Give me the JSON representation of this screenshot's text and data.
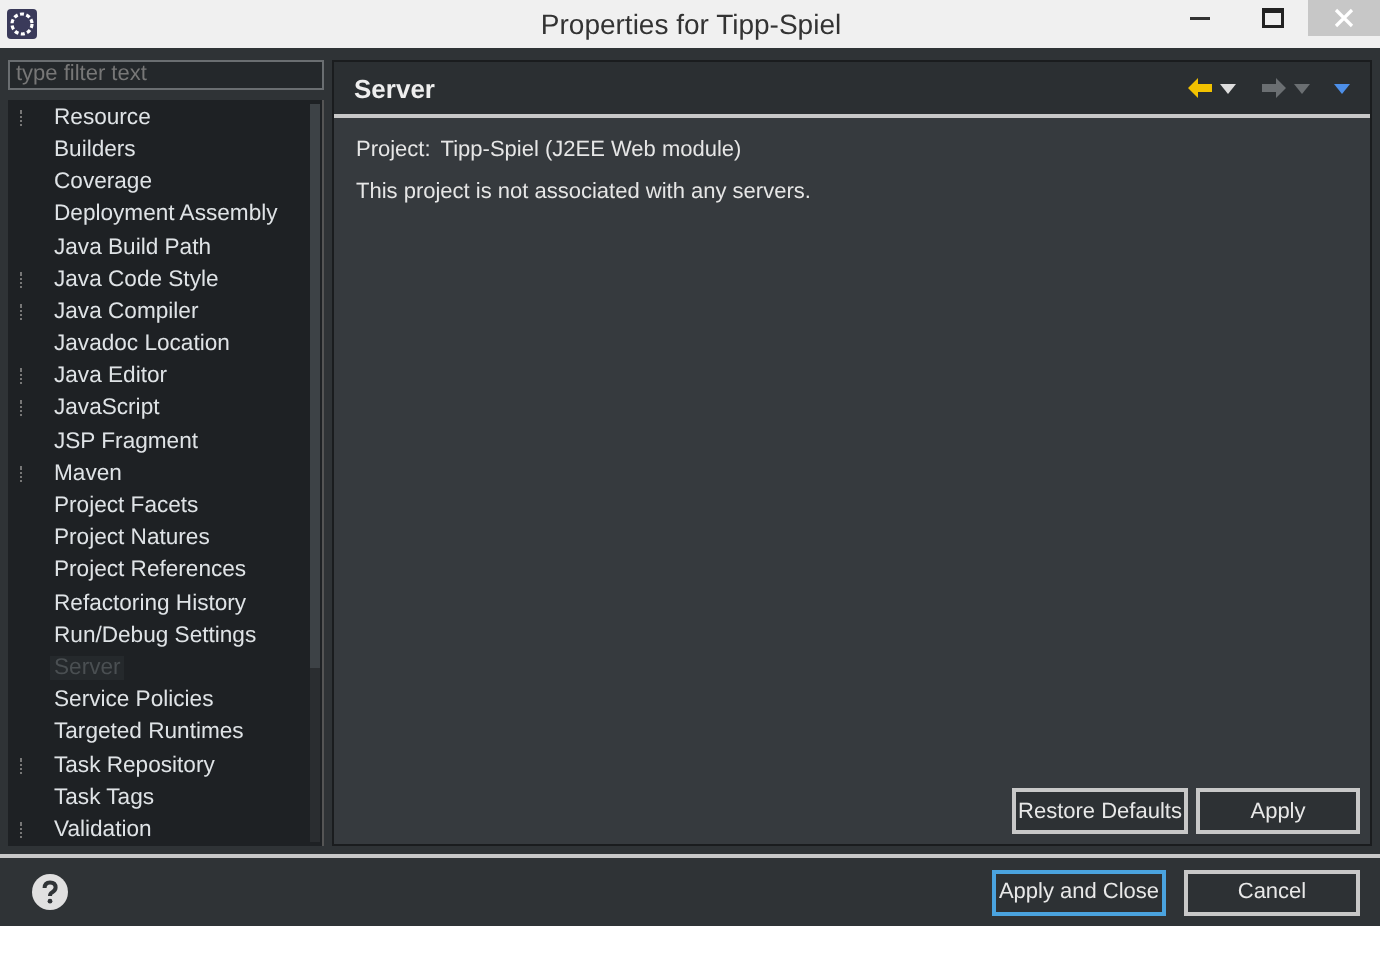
{
  "window": {
    "title": "Properties for Tipp-Spiel"
  },
  "filter": {
    "placeholder": "type filter text"
  },
  "tree": [
    {
      "label": "Resource",
      "expandable": true,
      "selected": false
    },
    {
      "label": "Builders",
      "expandable": false,
      "selected": false
    },
    {
      "label": "Coverage",
      "expandable": false,
      "selected": false
    },
    {
      "label": "Deployment Assembly",
      "expandable": false,
      "selected": false
    },
    {
      "label": "Java Build Path",
      "expandable": false,
      "selected": false
    },
    {
      "label": "Java Code Style",
      "expandable": true,
      "selected": false
    },
    {
      "label": "Java Compiler",
      "expandable": true,
      "selected": false
    },
    {
      "label": "Javadoc Location",
      "expandable": false,
      "selected": false
    },
    {
      "label": "Java Editor",
      "expandable": true,
      "selected": false
    },
    {
      "label": "JavaScript",
      "expandable": true,
      "selected": false
    },
    {
      "label": "JSP Fragment",
      "expandable": false,
      "selected": false
    },
    {
      "label": "Maven",
      "expandable": true,
      "selected": false
    },
    {
      "label": "Project Facets",
      "expandable": false,
      "selected": false
    },
    {
      "label": "Project Natures",
      "expandable": false,
      "selected": false
    },
    {
      "label": "Project References",
      "expandable": false,
      "selected": false
    },
    {
      "label": "Refactoring History",
      "expandable": false,
      "selected": false
    },
    {
      "label": "Run/Debug Settings",
      "expandable": false,
      "selected": false
    },
    {
      "label": "Server",
      "expandable": false,
      "selected": true
    },
    {
      "label": "Service Policies",
      "expandable": false,
      "selected": false
    },
    {
      "label": "Targeted Runtimes",
      "expandable": false,
      "selected": false
    },
    {
      "label": "Task Repository",
      "expandable": true,
      "selected": false
    },
    {
      "label": "Task Tags",
      "expandable": false,
      "selected": false
    },
    {
      "label": "Validation",
      "expandable": true,
      "selected": false
    }
  ],
  "page": {
    "title": "Server",
    "project_label": "Project:",
    "project_value": "Tipp-Spiel (J2EE Web module)",
    "message": "This project is not associated with any servers.",
    "back_disabled": false,
    "forward_disabled": true
  },
  "page_buttons": [
    "Restore Defaults",
    "Apply"
  ],
  "dialog_buttons": [
    {
      "label": "Apply and Close",
      "default": true
    },
    {
      "label": "Cancel",
      "default": false
    }
  ]
}
